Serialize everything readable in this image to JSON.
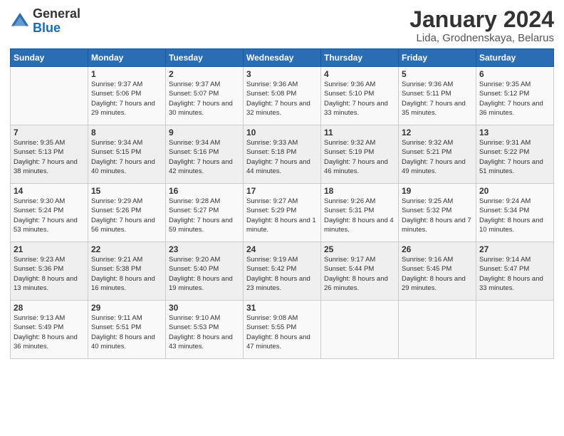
{
  "header": {
    "logo_general": "General",
    "logo_blue": "Blue",
    "month": "January 2024",
    "location": "Lida, Grodnenskaya, Belarus"
  },
  "days_of_week": [
    "Sunday",
    "Monday",
    "Tuesday",
    "Wednesday",
    "Thursday",
    "Friday",
    "Saturday"
  ],
  "weeks": [
    [
      {
        "day": "",
        "sunrise": "",
        "sunset": "",
        "daylight": ""
      },
      {
        "day": "1",
        "sunrise": "Sunrise: 9:37 AM",
        "sunset": "Sunset: 5:06 PM",
        "daylight": "Daylight: 7 hours and 29 minutes."
      },
      {
        "day": "2",
        "sunrise": "Sunrise: 9:37 AM",
        "sunset": "Sunset: 5:07 PM",
        "daylight": "Daylight: 7 hours and 30 minutes."
      },
      {
        "day": "3",
        "sunrise": "Sunrise: 9:36 AM",
        "sunset": "Sunset: 5:08 PM",
        "daylight": "Daylight: 7 hours and 32 minutes."
      },
      {
        "day": "4",
        "sunrise": "Sunrise: 9:36 AM",
        "sunset": "Sunset: 5:10 PM",
        "daylight": "Daylight: 7 hours and 33 minutes."
      },
      {
        "day": "5",
        "sunrise": "Sunrise: 9:36 AM",
        "sunset": "Sunset: 5:11 PM",
        "daylight": "Daylight: 7 hours and 35 minutes."
      },
      {
        "day": "6",
        "sunrise": "Sunrise: 9:35 AM",
        "sunset": "Sunset: 5:12 PM",
        "daylight": "Daylight: 7 hours and 36 minutes."
      }
    ],
    [
      {
        "day": "7",
        "sunrise": "Sunrise: 9:35 AM",
        "sunset": "Sunset: 5:13 PM",
        "daylight": "Daylight: 7 hours and 38 minutes."
      },
      {
        "day": "8",
        "sunrise": "Sunrise: 9:34 AM",
        "sunset": "Sunset: 5:15 PM",
        "daylight": "Daylight: 7 hours and 40 minutes."
      },
      {
        "day": "9",
        "sunrise": "Sunrise: 9:34 AM",
        "sunset": "Sunset: 5:16 PM",
        "daylight": "Daylight: 7 hours and 42 minutes."
      },
      {
        "day": "10",
        "sunrise": "Sunrise: 9:33 AM",
        "sunset": "Sunset: 5:18 PM",
        "daylight": "Daylight: 7 hours and 44 minutes."
      },
      {
        "day": "11",
        "sunrise": "Sunrise: 9:32 AM",
        "sunset": "Sunset: 5:19 PM",
        "daylight": "Daylight: 7 hours and 46 minutes."
      },
      {
        "day": "12",
        "sunrise": "Sunrise: 9:32 AM",
        "sunset": "Sunset: 5:21 PM",
        "daylight": "Daylight: 7 hours and 49 minutes."
      },
      {
        "day": "13",
        "sunrise": "Sunrise: 9:31 AM",
        "sunset": "Sunset: 5:22 PM",
        "daylight": "Daylight: 7 hours and 51 minutes."
      }
    ],
    [
      {
        "day": "14",
        "sunrise": "Sunrise: 9:30 AM",
        "sunset": "Sunset: 5:24 PM",
        "daylight": "Daylight: 7 hours and 53 minutes."
      },
      {
        "day": "15",
        "sunrise": "Sunrise: 9:29 AM",
        "sunset": "Sunset: 5:26 PM",
        "daylight": "Daylight: 7 hours and 56 minutes."
      },
      {
        "day": "16",
        "sunrise": "Sunrise: 9:28 AM",
        "sunset": "Sunset: 5:27 PM",
        "daylight": "Daylight: 7 hours and 59 minutes."
      },
      {
        "day": "17",
        "sunrise": "Sunrise: 9:27 AM",
        "sunset": "Sunset: 5:29 PM",
        "daylight": "Daylight: 8 hours and 1 minute."
      },
      {
        "day": "18",
        "sunrise": "Sunrise: 9:26 AM",
        "sunset": "Sunset: 5:31 PM",
        "daylight": "Daylight: 8 hours and 4 minutes."
      },
      {
        "day": "19",
        "sunrise": "Sunrise: 9:25 AM",
        "sunset": "Sunset: 5:32 PM",
        "daylight": "Daylight: 8 hours and 7 minutes."
      },
      {
        "day": "20",
        "sunrise": "Sunrise: 9:24 AM",
        "sunset": "Sunset: 5:34 PM",
        "daylight": "Daylight: 8 hours and 10 minutes."
      }
    ],
    [
      {
        "day": "21",
        "sunrise": "Sunrise: 9:23 AM",
        "sunset": "Sunset: 5:36 PM",
        "daylight": "Daylight: 8 hours and 13 minutes."
      },
      {
        "day": "22",
        "sunrise": "Sunrise: 9:21 AM",
        "sunset": "Sunset: 5:38 PM",
        "daylight": "Daylight: 8 hours and 16 minutes."
      },
      {
        "day": "23",
        "sunrise": "Sunrise: 9:20 AM",
        "sunset": "Sunset: 5:40 PM",
        "daylight": "Daylight: 8 hours and 19 minutes."
      },
      {
        "day": "24",
        "sunrise": "Sunrise: 9:19 AM",
        "sunset": "Sunset: 5:42 PM",
        "daylight": "Daylight: 8 hours and 23 minutes."
      },
      {
        "day": "25",
        "sunrise": "Sunrise: 9:17 AM",
        "sunset": "Sunset: 5:44 PM",
        "daylight": "Daylight: 8 hours and 26 minutes."
      },
      {
        "day": "26",
        "sunrise": "Sunrise: 9:16 AM",
        "sunset": "Sunset: 5:45 PM",
        "daylight": "Daylight: 8 hours and 29 minutes."
      },
      {
        "day": "27",
        "sunrise": "Sunrise: 9:14 AM",
        "sunset": "Sunset: 5:47 PM",
        "daylight": "Daylight: 8 hours and 33 minutes."
      }
    ],
    [
      {
        "day": "28",
        "sunrise": "Sunrise: 9:13 AM",
        "sunset": "Sunset: 5:49 PM",
        "daylight": "Daylight: 8 hours and 36 minutes."
      },
      {
        "day": "29",
        "sunrise": "Sunrise: 9:11 AM",
        "sunset": "Sunset: 5:51 PM",
        "daylight": "Daylight: 8 hours and 40 minutes."
      },
      {
        "day": "30",
        "sunrise": "Sunrise: 9:10 AM",
        "sunset": "Sunset: 5:53 PM",
        "daylight": "Daylight: 8 hours and 43 minutes."
      },
      {
        "day": "31",
        "sunrise": "Sunrise: 9:08 AM",
        "sunset": "Sunset: 5:55 PM",
        "daylight": "Daylight: 8 hours and 47 minutes."
      },
      {
        "day": "",
        "sunrise": "",
        "sunset": "",
        "daylight": ""
      },
      {
        "day": "",
        "sunrise": "",
        "sunset": "",
        "daylight": ""
      },
      {
        "day": "",
        "sunrise": "",
        "sunset": "",
        "daylight": ""
      }
    ]
  ]
}
